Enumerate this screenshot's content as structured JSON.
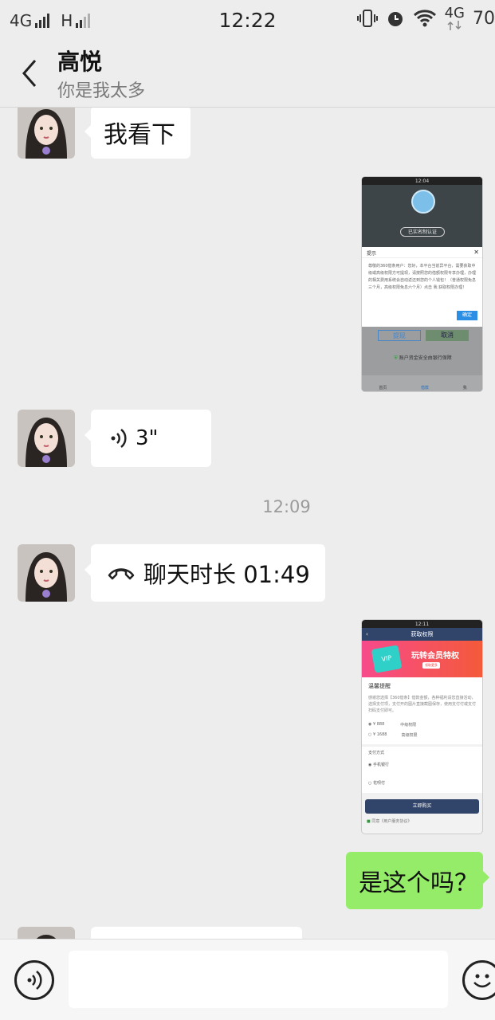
{
  "status_bar": {
    "network1": "4G",
    "network2": "H",
    "time": "12:22",
    "network3": "4G",
    "battery": "70"
  },
  "nav": {
    "title": "高悦",
    "subtitle": "你是我太多"
  },
  "messages": {
    "m1_text": "我看下",
    "m3_voice_duration": "3\"",
    "timestamp": "12:09",
    "m4_call_text": "聊天时长 01:49",
    "m6_text": "是这个吗？"
  },
  "shot1": {
    "time": "12:04",
    "verified": "已实名制认证",
    "dialog_title": "提示",
    "dialog_body": "尊敬的360借条用户：您好，本平台当前异平台，需要获取中级或高级权限方可提现，请按照您的借额权限专享办理，办理的相关费用系统会自动返还到您的个人钱包！（普通权限免息三个月，高级权限免息六个月）点击 我 获取权限办理！",
    "confirm": "确定",
    "btn_withdraw": "提现",
    "btn_cancel": "取消",
    "safety": "账户资金安全由银行保障",
    "tab1": "首页",
    "tab2": "借款",
    "tab3": "我"
  },
  "shot2": {
    "time": "12:11",
    "title": "获取权限",
    "banner_text": "玩转会员特权",
    "banner_btn": "领取更多",
    "section_title": "温馨提醒",
    "notice": "感谢您选择【360借条】借款金额，各种福利请您直接活动，选择支付项，支付开的图片直接截图保存，使用支付付或支付扫码支付即可。",
    "opt1_price": "¥ 888",
    "opt1_label": "中级权限",
    "opt2_price": "¥ 1688",
    "opt2_label": "高级权限",
    "pay_title": "支付方式",
    "pay1": "手机银行",
    "pay2": "花呗付",
    "buy": "立即购买",
    "agree": "同意《用户服务协议》"
  }
}
